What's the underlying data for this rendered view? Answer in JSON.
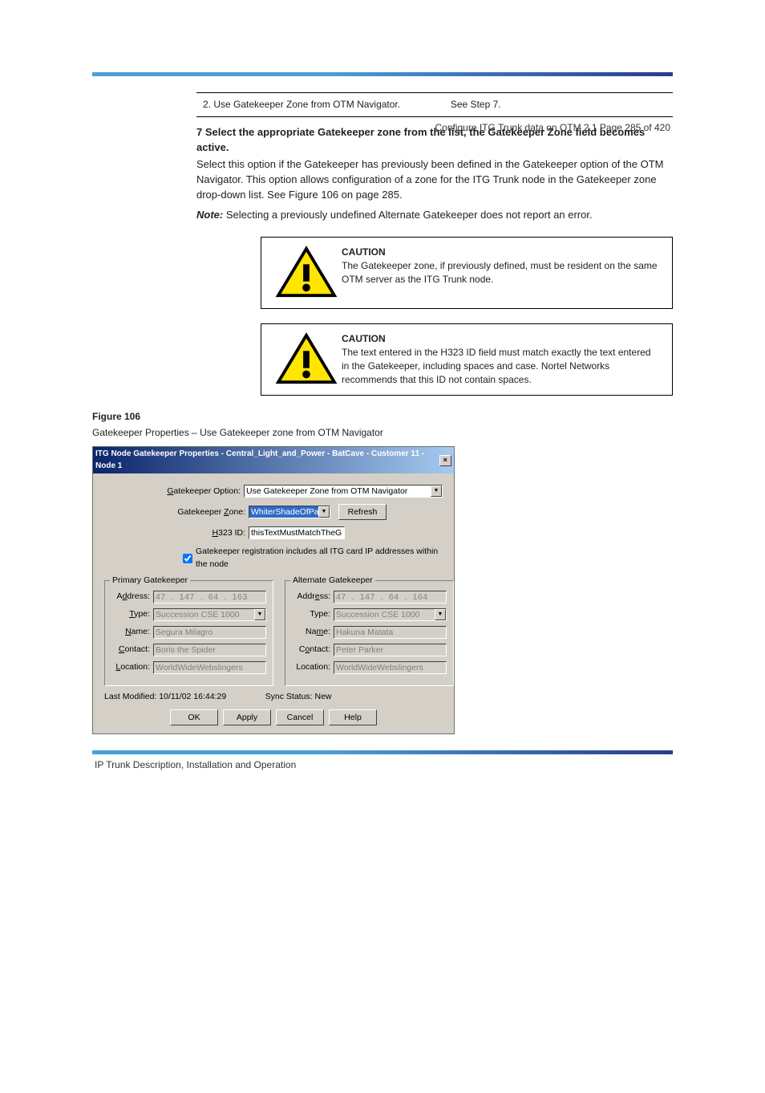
{
  "header": {
    "right_text": "Configure ITG Trunk data on OTM 2.1   Page 285 of 420"
  },
  "table": {
    "left": "2. Use Gatekeeper Zone from OTM Navigator.",
    "right": "See Step 7."
  },
  "step7": {
    "heading": "7   Select the appropriate Gatekeeper zone from the list, the Gatekeeper Zone field becomes active.",
    "body": "Select this option if the Gatekeeper has previously been defined in the Gatekeeper option of the OTM Navigator. This option allows configuration of a zone for the ITG Trunk node in the Gatekeeper zone drop-down list. See Figure 106 on page 285.",
    "note_label": "Note:",
    "note_body": "Selecting a previously undefined Alternate Gatekeeper does not report an error."
  },
  "caution1": {
    "title": "CAUTION",
    "body": "The Gatekeeper zone, if previously defined, must be resident on the same OTM server as the ITG Trunk node."
  },
  "caution2": {
    "title": "CAUTION",
    "body": "The text entered in the H323 ID field must match exactly the text entered in the Gatekeeper, including spaces and case. Nortel Networks recommends that this ID not contain spaces."
  },
  "figure": {
    "label": "Figure 106",
    "caption": "Gatekeeper Properties – Use Gatekeeper zone from OTM Navigator"
  },
  "dialog": {
    "title": "ITG Node Gatekeeper Properties - Central_Light_and_Power - BatCave - Customer 11 - Node 1",
    "gatekeeper_option_label": "Gatekeeper Option:",
    "gatekeeper_option_value": "Use Gatekeeper Zone from OTM Navigator",
    "gatekeeper_zone_label": "Gatekeeper Zone:",
    "gatekeeper_zone_value": "WhiterShadeOfPale",
    "refresh_btn": "Refresh",
    "h323id_label": "H323 ID:",
    "h323id_value": "thisTextMustMatchTheGk",
    "checkbox_label": "Gatekeeper registration includes all ITG card IP addresses within the node",
    "primary_legend": "Primary Gatekeeper",
    "alternate_legend": "Alternate Gatekeeper",
    "primary": {
      "address_label": "Address:",
      "address": "47  .  147  .  64  .  163",
      "type_label": "Type:",
      "type": "Succession CSE 1000",
      "name_label": "Name:",
      "name": "Segura Milagro",
      "contact_label": "Contact:",
      "contact": "Boris the Spider",
      "location_label": "Location:",
      "location": "WorldWideWebslingers"
    },
    "alternate": {
      "address_label": "Address:",
      "address": "47  .  147  .  64  .  164",
      "type_label": "Type:",
      "type": "Succession CSE 1000",
      "name_label": "Name:",
      "name": "Hakuna Matata",
      "contact_label": "Contact:",
      "contact": "Peter Parker",
      "location_label": "Location:",
      "location": "WorldWideWebslingers"
    },
    "last_modified": "Last Modified: 10/11/02 16:44:29",
    "sync_status": "Sync Status:  New",
    "ok_btn": "OK",
    "apply_btn": "Apply",
    "cancel_btn": "Cancel",
    "help_btn": "Help"
  },
  "footer": {
    "left": "IP Trunk   Description, Installation and Operation"
  }
}
